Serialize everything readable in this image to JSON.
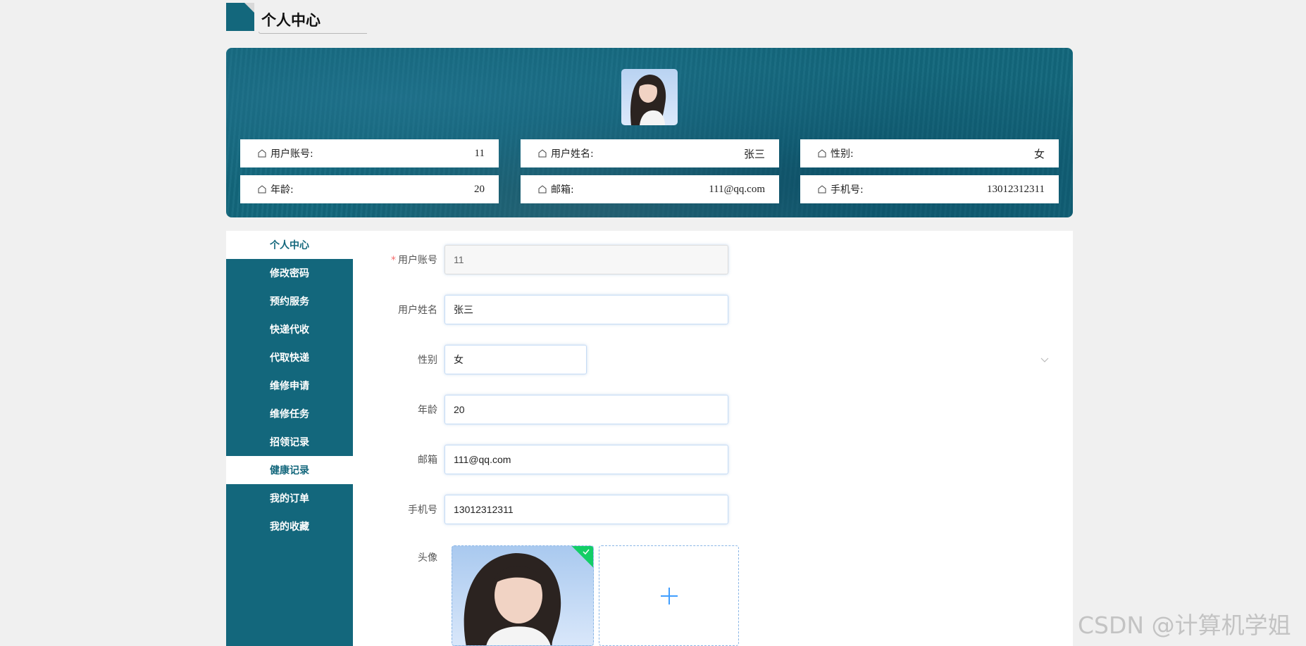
{
  "page_title": "个人中心",
  "profile_cards": [
    {
      "label": "用户账号:",
      "value": "11"
    },
    {
      "label": "用户姓名:",
      "value": "张三"
    },
    {
      "label": "性别:",
      "value": "女"
    },
    {
      "label": "年龄:",
      "value": "20"
    },
    {
      "label": "邮箱:",
      "value": "111@qq.com"
    },
    {
      "label": "手机号:",
      "value": "13012312311"
    }
  ],
  "sidebar": {
    "items": [
      {
        "label": "个人中心",
        "active": true
      },
      {
        "label": "修改密码"
      },
      {
        "label": "预约服务"
      },
      {
        "label": "快递代收"
      },
      {
        "label": "代取快递"
      },
      {
        "label": "维修申请"
      },
      {
        "label": "维修任务"
      },
      {
        "label": "招领记录"
      },
      {
        "label": "健康记录",
        "active": true
      },
      {
        "label": "我的订单"
      },
      {
        "label": "我的收藏"
      }
    ]
  },
  "form": {
    "account_label": "用户账号",
    "account_value": "11",
    "name_label": "用户姓名",
    "name_value": "张三",
    "gender_label": "性别",
    "gender_value": "女",
    "age_label": "年龄",
    "age_value": "20",
    "email_label": "邮箱",
    "email_value": "111@qq.com",
    "phone_label": "手机号",
    "phone_value": "13012312311",
    "avatar_label": "头像",
    "required_mark": "*"
  },
  "watermark": "CSDN @计算机学姐",
  "colors": {
    "primary": "#13677c",
    "success": "#13ce66",
    "upload_plus": "#409eff"
  }
}
